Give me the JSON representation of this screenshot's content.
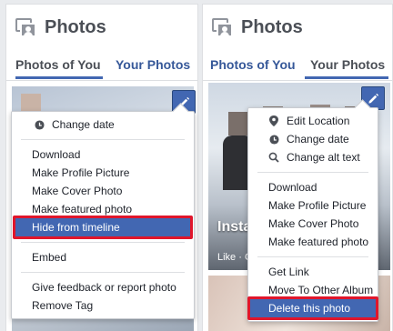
{
  "left_panel": {
    "title": "Photos",
    "tabs": [
      {
        "label": "Photos of You",
        "active": true
      },
      {
        "label": "Your Photos",
        "active": false
      }
    ],
    "menu": {
      "items": [
        {
          "label": "Change date",
          "icon": "clock-icon"
        },
        {
          "label": "Download"
        },
        {
          "label": "Make Profile Picture"
        },
        {
          "label": "Make Cover Photo"
        },
        {
          "label": "Make featured photo"
        },
        {
          "label": "Hide from timeline",
          "selected": true
        },
        {
          "label": "Embed"
        },
        {
          "label": "Give feedback or report photo"
        },
        {
          "label": "Remove Tag"
        }
      ]
    }
  },
  "right_panel": {
    "title": "Photos",
    "tabs": [
      {
        "label": "Photos of You",
        "active": false
      },
      {
        "label": "Your Photos",
        "active": true
      }
    ],
    "photo_overlay": {
      "title": "Instag",
      "like": "Like · C"
    },
    "menu": {
      "items": [
        {
          "label": "Edit Location",
          "icon": "location-pin-icon"
        },
        {
          "label": "Change date",
          "icon": "clock-icon"
        },
        {
          "label": "Change alt text",
          "icon": "magnifier-icon"
        },
        {
          "label": "Download"
        },
        {
          "label": "Make Profile Picture"
        },
        {
          "label": "Make Cover Photo"
        },
        {
          "label": "Make featured photo"
        },
        {
          "label": "Get Link"
        },
        {
          "label": "Move To Other Album"
        },
        {
          "label": "Delete this photo",
          "selected": true
        }
      ]
    }
  },
  "colors": {
    "brand": "#4267b2",
    "link": "#365899",
    "highlight_border": "#e0162b"
  }
}
